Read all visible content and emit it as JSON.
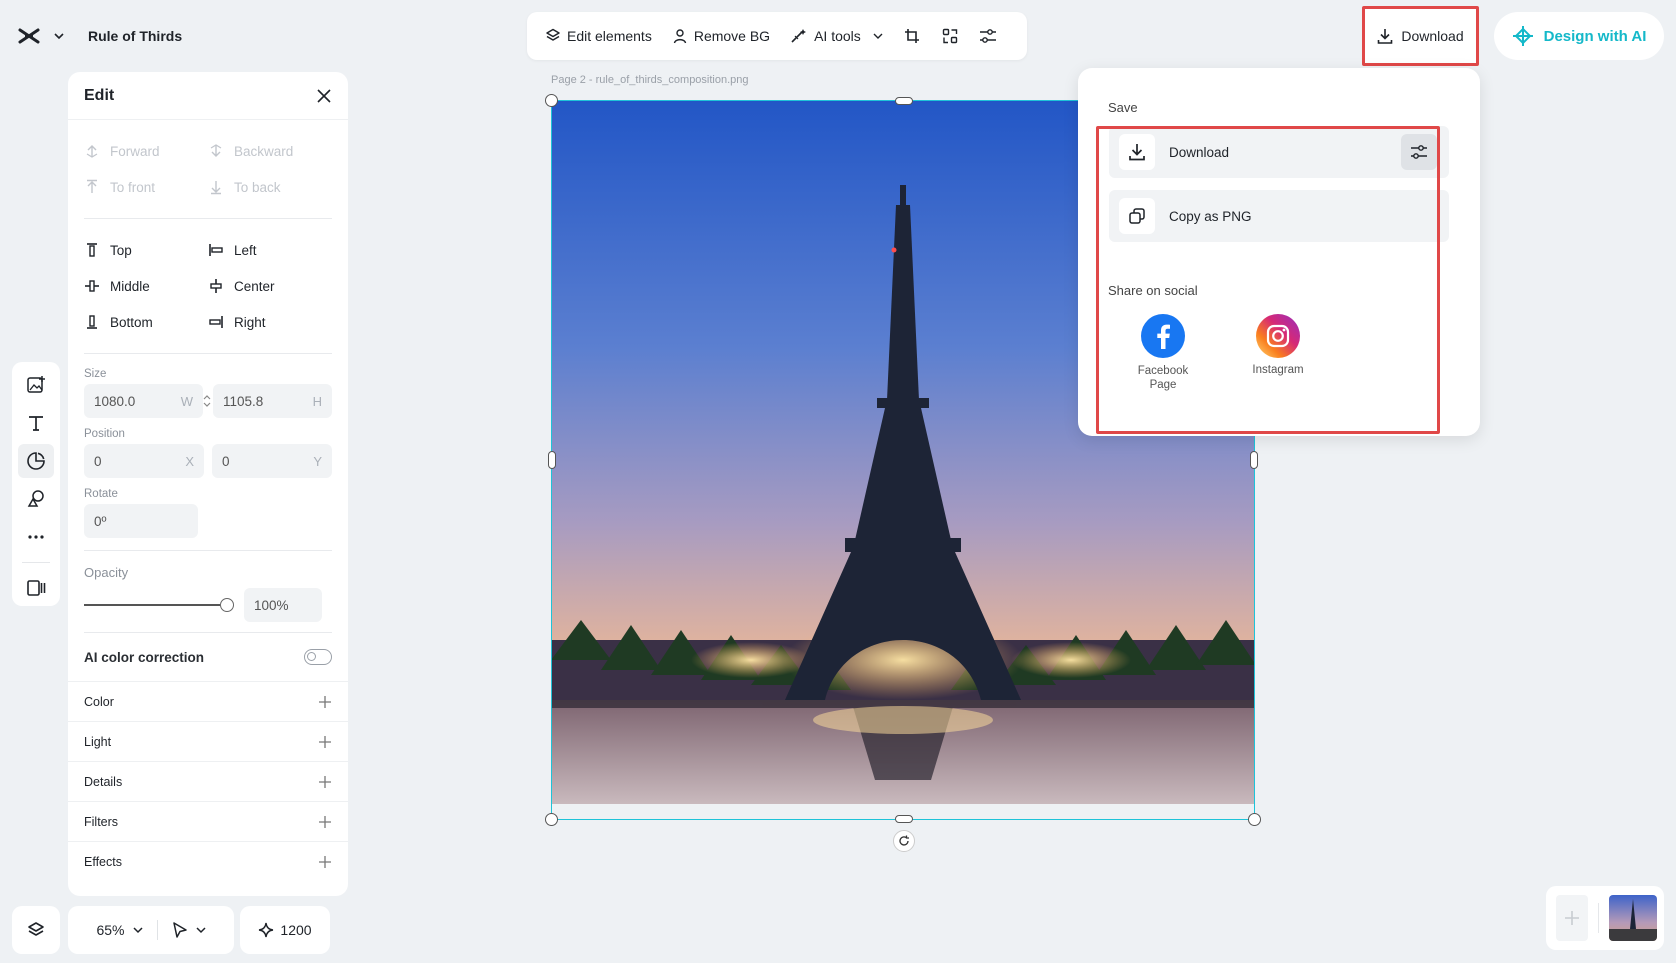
{
  "header": {
    "project_title": "Rule of Thirds"
  },
  "toolbar": {
    "edit_elements": "Edit elements",
    "remove_bg": "Remove BG",
    "ai_tools": "AI tools"
  },
  "top_right": {
    "download": "Download",
    "design_with_ai": "Design with AI"
  },
  "edit_panel": {
    "title": "Edit",
    "order": {
      "forward": "Forward",
      "backward": "Backward",
      "to_front": "To front",
      "to_back": "To back"
    },
    "align": {
      "top": "Top",
      "left": "Left",
      "middle": "Middle",
      "center": "Center",
      "bottom": "Bottom",
      "right": "Right"
    },
    "size_label": "Size",
    "width": "1080.0",
    "width_suffix": "W",
    "height": "1105.8",
    "height_suffix": "H",
    "position_label": "Position",
    "pos_x": "0",
    "pos_x_suffix": "X",
    "pos_y": "0",
    "pos_y_suffix": "Y",
    "rotate_label": "Rotate",
    "rotate": "0º",
    "opacity_label": "Opacity",
    "opacity": "100%",
    "opacity_fraction": 1.0,
    "ai_color_correction": "AI color correction",
    "ai_color_correction_on": false,
    "sections": [
      "Color",
      "Light",
      "Details",
      "Filters",
      "Effects"
    ]
  },
  "bottom_bar": {
    "zoom": "65%",
    "credits": "1200"
  },
  "canvas": {
    "page_label": "Page 2 -  rule_of_thirds_composition.png"
  },
  "download_popup": {
    "save_label": "Save",
    "download": "Download",
    "copy_png": "Copy as PNG",
    "share_label": "Share on social",
    "facebook": "Facebook Page",
    "instagram": "Instagram"
  },
  "colors": {
    "accent": "#1ec3d8",
    "highlight": "#e04848",
    "facebook": "#1877f2"
  }
}
